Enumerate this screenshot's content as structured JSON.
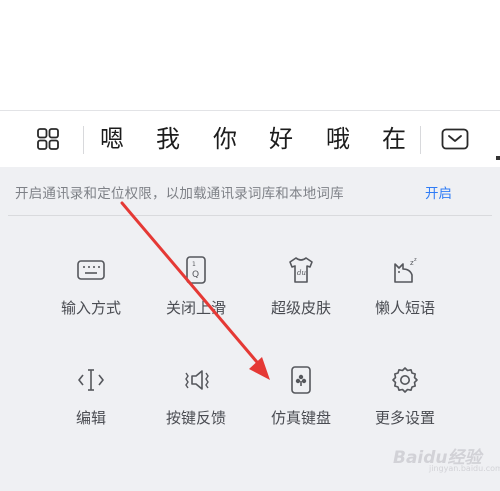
{
  "candidate_bar": {
    "grid_icon": "grid-four-squares-icon",
    "candidates": [
      "嗯",
      "我",
      "你",
      "好",
      "哦",
      "在"
    ],
    "collapse_icon": "keyboard-collapse-icon"
  },
  "notice": {
    "text": "开启通讯录和定位权限，以加载通讯录词库和本地词库",
    "link": "开启",
    "link_color": "#2f7cf6"
  },
  "tools": [
    {
      "label": "输入方式",
      "icon": "keyboard-icon"
    },
    {
      "label": "关闭上滑",
      "icon": "swipe-up-card-icon"
    },
    {
      "label": "超级皮肤",
      "icon": "tshirt-skin-icon"
    },
    {
      "label": "懒人短语",
      "icon": "lazy-cat-phrase-icon"
    },
    {
      "label": "编辑",
      "icon": "text-cursor-edit-icon"
    },
    {
      "label": "按键反馈",
      "icon": "speaker-vibrate-icon"
    },
    {
      "label": "仿真键盘",
      "icon": "playing-card-icon"
    },
    {
      "label": "更多设置",
      "icon": "gear-icon"
    }
  ],
  "watermark": {
    "text": "Baidu经验",
    "sub": "jingyan.baidu.com"
  },
  "colors": {
    "panel_bg": "#eff0f3",
    "icon_stroke": "#55575c",
    "annotation_arrow": "#e53935"
  }
}
